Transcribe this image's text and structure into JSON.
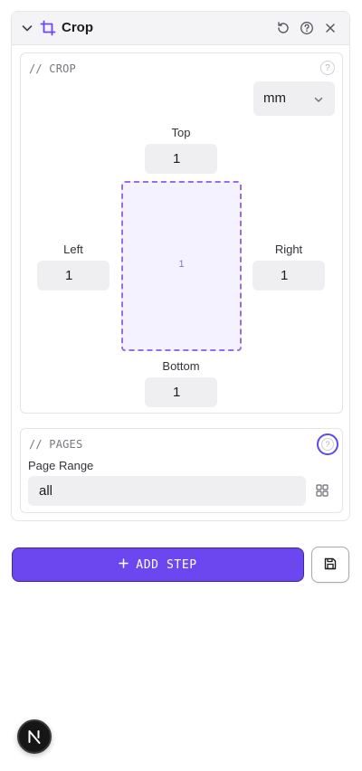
{
  "panel": {
    "title": "Crop",
    "icons": {
      "collapse": "chevron-down-icon",
      "crop": "crop-icon",
      "reset": "reset-icon",
      "help": "help-icon",
      "close": "close-icon"
    }
  },
  "crop": {
    "section_label": "// CROP",
    "unit": "mm",
    "top_label": "Top",
    "top_value": "1",
    "left_label": "Left",
    "left_value": "1",
    "right_label": "Right",
    "right_value": "1",
    "bottom_label": "Bottom",
    "bottom_value": "1",
    "preview_page_number": "1"
  },
  "pages": {
    "section_label": "// PAGES",
    "range_label": "Page Range",
    "range_value": "all"
  },
  "actions": {
    "add_step_label": "ADD STEP",
    "add_step_icon": "plus-icon",
    "save_icon": "save-icon"
  },
  "badge": {
    "letter": "N"
  },
  "colors": {
    "accent": "#6c47f0",
    "preview_border": "#9a6de0",
    "preview_fill": "#f5f2ff",
    "help_ring": "#5b4be8"
  }
}
